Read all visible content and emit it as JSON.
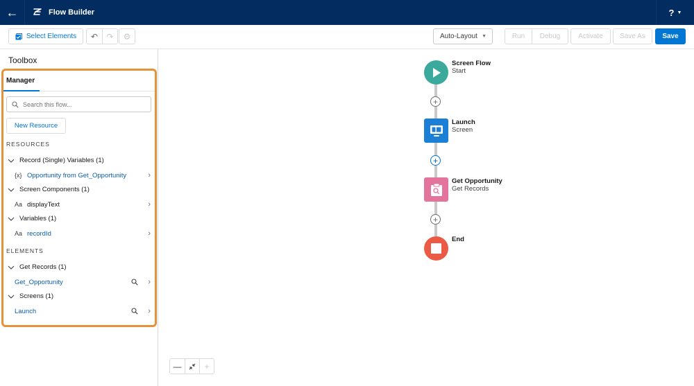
{
  "header": {
    "app_title": "Flow Builder",
    "back_icon": "arrow-left-icon",
    "logo_icon": "flow-icon",
    "help_label": "?",
    "help_icon": "question-icon"
  },
  "toolbar": {
    "select_elements_label": "Select Elements",
    "undo_icon": "undo-icon",
    "redo_icon": "redo-icon",
    "settings_icon": "gear-icon",
    "layout_select": {
      "value": "Auto-Layout"
    },
    "run_label": "Run",
    "debug_label": "Debug",
    "activate_label": "Activate",
    "save_as_label": "Save As",
    "save_label": "Save"
  },
  "sidebar": {
    "title": "Toolbox",
    "tab": "Manager",
    "search_placeholder": "Search this flow...",
    "new_resource_label": "New Resource",
    "resources_heading": "RESOURCES",
    "resource_groups": [
      {
        "label": "Record (Single) Variables (1)",
        "items": [
          {
            "type": "{x}",
            "label": "Opportunity from Get_Opportunity"
          }
        ]
      },
      {
        "label": "Screen Components (1)",
        "items": [
          {
            "type": "Aa",
            "label": "displayText"
          }
        ]
      },
      {
        "label": "Variables (1)",
        "items": [
          {
            "type": "Aa",
            "label": "recordId"
          }
        ]
      }
    ],
    "elements_heading": "ELEMENTS",
    "element_groups": [
      {
        "label": "Get Records (1)",
        "items": [
          {
            "label": "Get_Opportunity"
          }
        ]
      },
      {
        "label": "Screens (1)",
        "items": [
          {
            "label": "Launch"
          }
        ]
      }
    ]
  },
  "canvas": {
    "nodes": [
      {
        "title": "Screen Flow",
        "subtitle": "Start",
        "kind": "start",
        "color": "#3ba99c"
      },
      {
        "title": "Launch",
        "subtitle": "Screen",
        "kind": "screen",
        "color": "#1b7fd6"
      },
      {
        "title": "Get Opportunity",
        "subtitle": "Get Records",
        "kind": "get-records",
        "color": "#e3749b"
      },
      {
        "title": "End",
        "subtitle": "",
        "kind": "end",
        "color": "#ea5a45"
      }
    ],
    "zoom_out_label": "—",
    "zoom_in_label": "+"
  },
  "colors": {
    "header_bg": "#032d60",
    "brand": "#0176d3",
    "highlight": "#e5923b"
  }
}
